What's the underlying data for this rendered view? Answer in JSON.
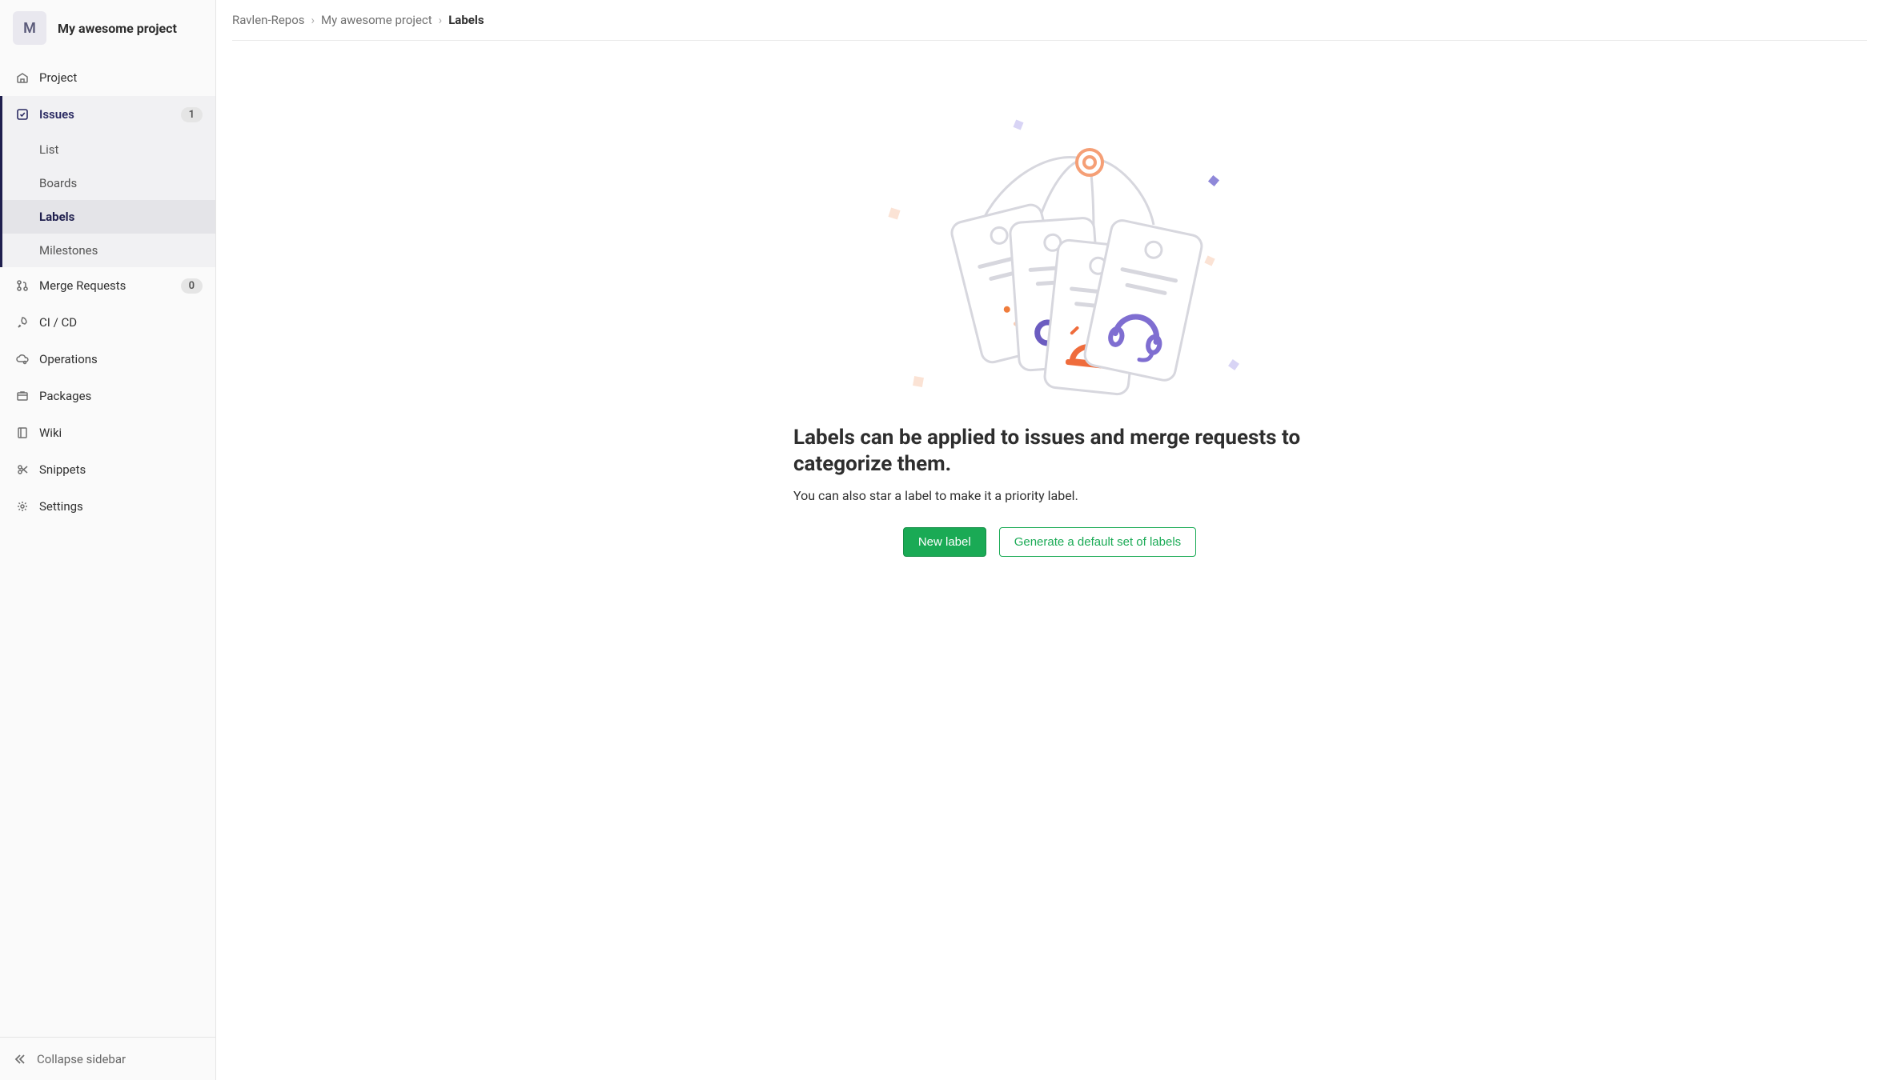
{
  "sidebar": {
    "avatar_letter": "M",
    "project_title": "My awesome project",
    "items": [
      {
        "label": "Project"
      },
      {
        "label": "Issues",
        "badge": "1"
      },
      {
        "label": "Merge Requests",
        "badge": "0"
      },
      {
        "label": "CI / CD"
      },
      {
        "label": "Operations"
      },
      {
        "label": "Packages"
      },
      {
        "label": "Wiki"
      },
      {
        "label": "Snippets"
      },
      {
        "label": "Settings"
      }
    ],
    "sub_items": [
      {
        "label": "List"
      },
      {
        "label": "Boards"
      },
      {
        "label": "Labels"
      },
      {
        "label": "Milestones"
      }
    ],
    "collapse_label": "Collapse sidebar"
  },
  "breadcrumbs": [
    "Ravlen-Repos",
    "My awesome project",
    "Labels"
  ],
  "empty": {
    "title": "Labels can be applied to issues and merge requests to categorize them.",
    "subtitle": "You can also star a label to make it a priority label.",
    "primary_btn": "New label",
    "secondary_btn": "Generate a default set of labels"
  }
}
